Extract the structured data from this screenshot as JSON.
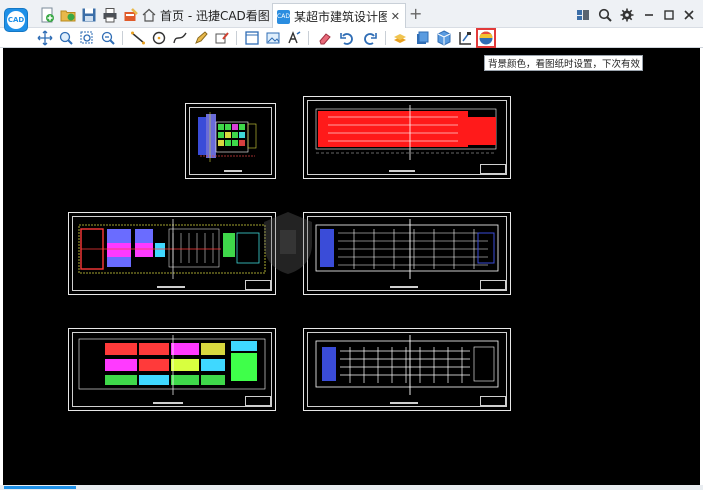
{
  "app": {
    "logo_text": "CAD"
  },
  "tabs": {
    "home_label": "首页 - 迅捷CAD看图",
    "active_label": "某超市建筑设计图....",
    "close_glyph": "✕",
    "add_glyph": "+",
    "active_icon_text": "CAD"
  },
  "tooltip": {
    "text": "背景颜色，看图纸时设置，下次有效"
  },
  "colors": {
    "canvas_bg": "#000000",
    "highlight": "#e23a3a",
    "accent": "#1e90e8"
  },
  "icons": {
    "quick_access": [
      "new-file-icon",
      "open-file-icon",
      "save-icon",
      "print-icon",
      "clear-icon"
    ],
    "window": [
      "screen-icon",
      "search-zoom-icon",
      "gear-icon",
      "minimize-icon",
      "maximize-icon",
      "close-icon"
    ],
    "toolbar": [
      "pan-icon",
      "zoom-window-icon",
      "zoom-extents-icon",
      "zoom-previous-icon",
      "line-icon",
      "circle-icon",
      "polyline-icon",
      "pen-icon",
      "text-edit-icon",
      "layout-icon",
      "image-icon",
      "text-style-icon",
      "eraser-icon",
      "undo-icon",
      "redo-icon",
      "layer-icon",
      "block-icon",
      "3d-view-icon",
      "measure-icon",
      "background-color-icon"
    ]
  }
}
